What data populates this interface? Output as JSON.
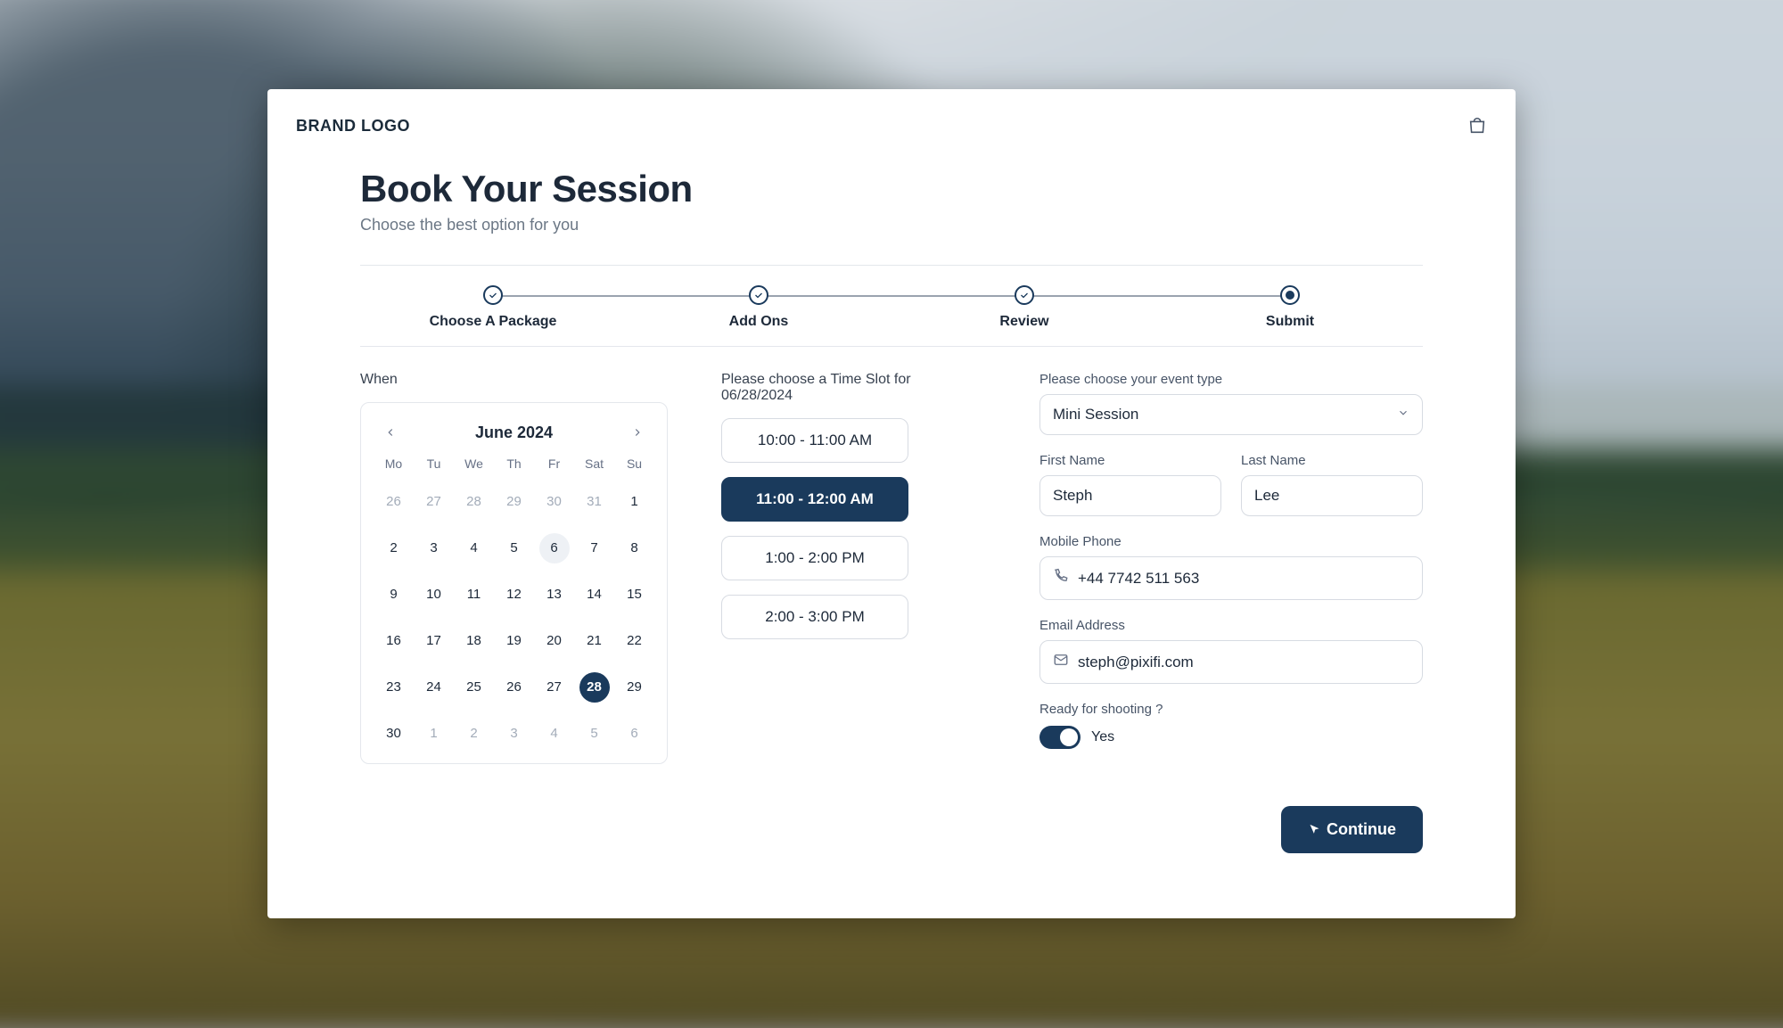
{
  "brand": "BRAND LOGO",
  "header": {
    "title": "Book Your Session",
    "subtitle": "Choose the best option for you"
  },
  "stepper": {
    "steps": [
      {
        "label": "Choose A Package",
        "state": "done"
      },
      {
        "label": "Add Ons",
        "state": "done"
      },
      {
        "label": "Review",
        "state": "done"
      },
      {
        "label": "Submit",
        "state": "current"
      }
    ]
  },
  "calendar": {
    "section_label": "When",
    "month_label": "June 2024",
    "dow": [
      "Mo",
      "Tu",
      "We",
      "Th",
      "Fr",
      "Sat",
      "Su"
    ],
    "today": 6,
    "selected": 28,
    "leading": [
      26,
      27,
      28,
      29,
      30,
      31
    ],
    "days": [
      1,
      2,
      3,
      4,
      5,
      6,
      7,
      8,
      9,
      10,
      11,
      12,
      13,
      14,
      15,
      16,
      17,
      18,
      19,
      20,
      21,
      22,
      23,
      24,
      25,
      26,
      27,
      28,
      29,
      30
    ],
    "trailing": [
      1,
      2,
      3,
      4,
      5,
      6
    ]
  },
  "timeslots": {
    "section_label": "Please choose a Time Slot for 06/28/2024",
    "options": [
      {
        "label": "10:00 - 11:00 AM",
        "active": false
      },
      {
        "label": "11:00 - 12:00 AM",
        "active": true
      },
      {
        "label": "1:00 - 2:00 PM",
        "active": false
      },
      {
        "label": "2:00 - 3:00 PM",
        "active": false
      }
    ]
  },
  "form": {
    "event_type_label": "Please choose your event type",
    "event_type_value": "Mini Session",
    "first_name_label": "First Name",
    "first_name_value": "Steph",
    "last_name_label": "Last Name",
    "last_name_value": "Lee",
    "phone_label": "Mobile Phone",
    "phone_value": "+44 7742 511 563",
    "email_label": "Email Address",
    "email_value": "steph@pixifi.com",
    "ready_label": "Ready for shooting ?",
    "ready_value_label": "Yes",
    "ready_value": true
  },
  "actions": {
    "continue": "Continue"
  }
}
